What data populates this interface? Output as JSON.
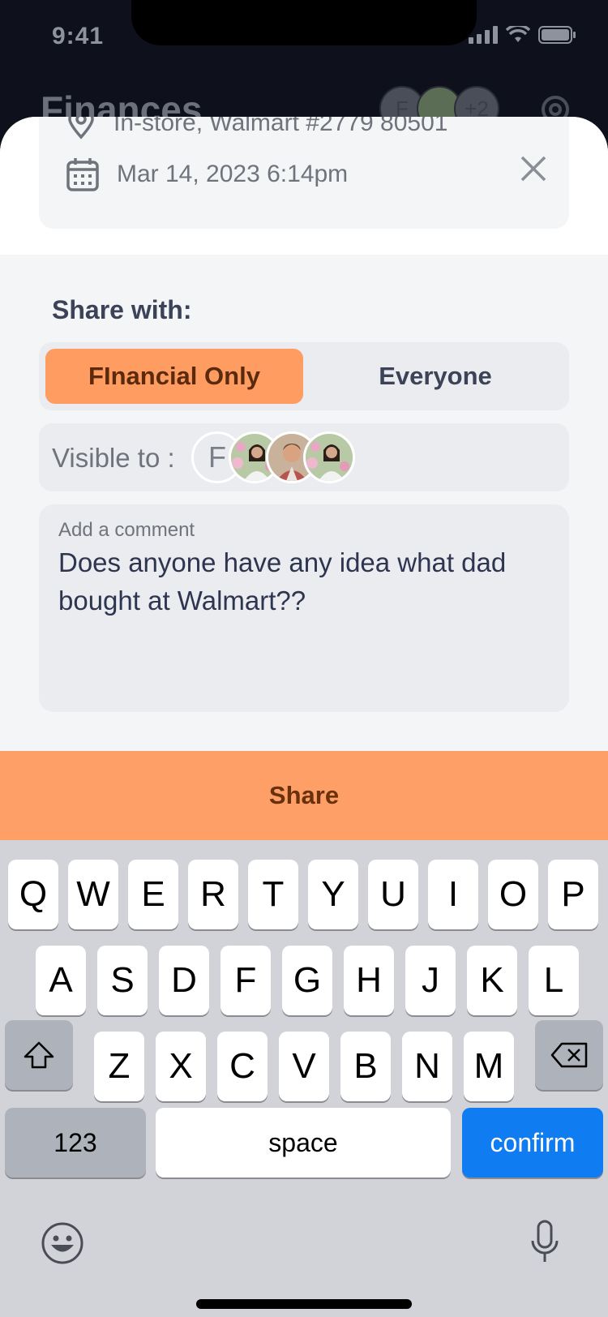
{
  "status_bar": {
    "time": "9:41"
  },
  "background_header": {
    "title": "Finances",
    "avatar_letter": "F",
    "more_count": "+2"
  },
  "transaction": {
    "location": "In-store, Walmart #2779 80501",
    "datetime": "Mar 14, 2023 6:14pm"
  },
  "share": {
    "label": "Share with:",
    "options": [
      "FInancial Only",
      "Everyone"
    ],
    "selected": "FInancial Only",
    "visible_label": "Visible to :",
    "visible_avatar_letter": "F",
    "comment_label": "Add a comment",
    "comment_value": "Does anyone have any idea what dad bought at Walmart??",
    "button_label": "Share"
  },
  "keyboard": {
    "row1": [
      "Q",
      "W",
      "E",
      "R",
      "T",
      "Y",
      "U",
      "I",
      "O",
      "P"
    ],
    "row2": [
      "A",
      "S",
      "D",
      "F",
      "G",
      "H",
      "J",
      "K",
      "L"
    ],
    "row3": [
      "Z",
      "X",
      "C",
      "V",
      "B",
      "N",
      "M"
    ],
    "numbers_label": "123",
    "space_label": "space",
    "confirm_label": "confirm"
  },
  "colors": {
    "accent": "#fe9c62",
    "confirm_blue": "#0f7cf2",
    "sheet_bg": "#f4f5f7"
  }
}
